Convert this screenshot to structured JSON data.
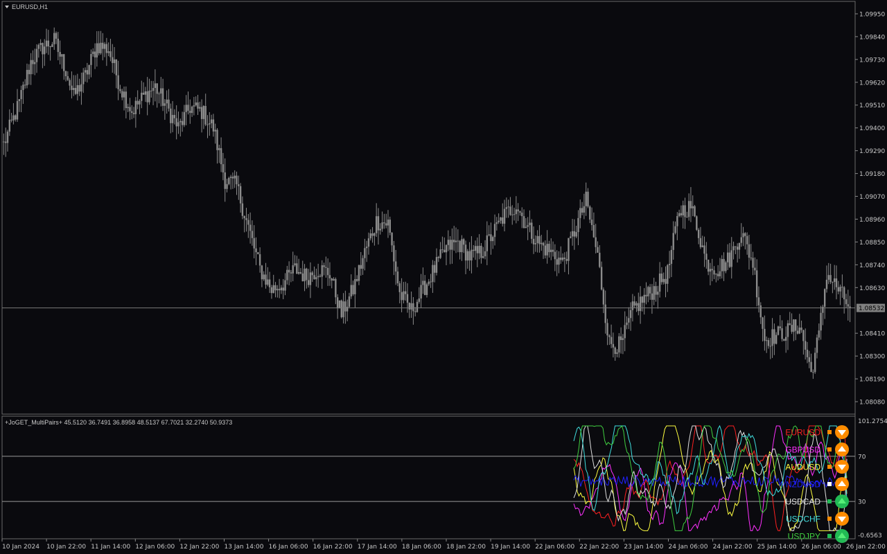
{
  "window": {
    "symbol_title": "EURUSD,H1",
    "indicator_title": "+JoGET_MultiPairs+ 45.5120 36.7491 36.8958 48.5137 67.7021 32.2740 50.9373"
  },
  "colors": {
    "background": "#0a0a0e",
    "candle": "#8c8c8c",
    "grid": "#5a5a5a",
    "axis_text": "#c8c8c8",
    "current_price_bg": "#808080",
    "arrow_up": "#22bb55",
    "arrow_down": "#ff8c00"
  },
  "chart_data": [
    {
      "type": "candlestick",
      "title": "EURUSD,H1",
      "symbol": "EURUSD",
      "timeframe": "H1",
      "y_ticks": [
        "1.09950",
        "1.09840",
        "1.09730",
        "1.09620",
        "1.09510",
        "1.09400",
        "1.09290",
        "1.09180",
        "1.09070",
        "1.08960",
        "1.08850",
        "1.08740",
        "1.08630",
        "1.08532",
        "1.08410",
        "1.08300",
        "1.08190",
        "1.08080"
      ],
      "ylim": [
        1.0802,
        1.1001
      ],
      "current_price": 1.08532,
      "current_price_label": "1.08532",
      "x_ticks": [
        "10 Jan 2024",
        "10 Jan 22:00",
        "11 Jan 14:00",
        "12 Jan 06:00",
        "12 Jan 22:00",
        "13 Jan 14:00",
        "16 Jan 06:00",
        "16 Jan 22:00",
        "17 Jan 14:00",
        "18 Jan 06:00",
        "18 Jan 22:00",
        "19 Jan 14:00",
        "22 Jan 06:00",
        "22 Jan 22:00",
        "23 Jan 14:00",
        "24 Jan 06:00",
        "24 Jan 22:00",
        "25 Jan 14:00",
        "26 Jan 06:00",
        "26 Jan 22:00"
      ],
      "close_anchors": [
        [
          0,
          1.0932
        ],
        [
          8,
          1.0952
        ],
        [
          14,
          1.0972
        ],
        [
          20,
          1.0979
        ],
        [
          26,
          1.0982
        ],
        [
          32,
          1.0968
        ],
        [
          36,
          1.0955
        ],
        [
          42,
          1.0965
        ],
        [
          48,
          1.098
        ],
        [
          54,
          1.0978
        ],
        [
          60,
          1.096
        ],
        [
          66,
          1.0948
        ],
        [
          72,
          1.0955
        ],
        [
          78,
          1.096
        ],
        [
          84,
          1.095
        ],
        [
          90,
          1.094
        ],
        [
          96,
          1.095
        ],
        [
          102,
          1.0948
        ],
        [
          108,
          1.094
        ],
        [
          114,
          1.0915
        ],
        [
          120,
          1.0912
        ],
        [
          126,
          1.0892
        ],
        [
          132,
          1.0872
        ],
        [
          138,
          1.0862
        ],
        [
          144,
          1.0865
        ],
        [
          150,
          1.0872
        ],
        [
          156,
          1.0868
        ],
        [
          162,
          1.0872
        ],
        [
          168,
          1.087
        ],
        [
          174,
          1.085
        ],
        [
          180,
          1.0862
        ],
        [
          186,
          1.088
        ],
        [
          192,
          1.0895
        ],
        [
          198,
          1.0894
        ],
        [
          204,
          1.086
        ],
        [
          210,
          1.0852
        ],
        [
          216,
          1.0862
        ],
        [
          222,
          1.0872
        ],
        [
          228,
          1.0882
        ],
        [
          234,
          1.0885
        ],
        [
          240,
          1.0878
        ],
        [
          246,
          1.088
        ],
        [
          252,
          1.0889
        ],
        [
          258,
          1.0898
        ],
        [
          264,
          1.0903
        ],
        [
          270,
          1.0892
        ],
        [
          276,
          1.0884
        ],
        [
          282,
          1.088
        ],
        [
          288,
          1.0875
        ],
        [
          294,
          1.089
        ],
        [
          300,
          1.0905
        ],
        [
          306,
          1.0878
        ],
        [
          312,
          1.0836
        ],
        [
          318,
          1.0835
        ],
        [
          324,
          1.0852
        ],
        [
          330,
          1.0858
        ],
        [
          336,
          1.0863
        ],
        [
          342,
          1.087
        ],
        [
          348,
          1.09
        ],
        [
          354,
          1.0902
        ],
        [
          358,
          1.089
        ],
        [
          362,
          1.0875
        ],
        [
          368,
          1.0872
        ],
        [
          374,
          1.0877
        ],
        [
          380,
          1.089
        ],
        [
          386,
          1.0875
        ],
        [
          392,
          1.0838
        ],
        [
          398,
          1.084
        ],
        [
          404,
          1.0842
        ],
        [
          410,
          1.0845
        ],
        [
          416,
          1.0822
        ],
        [
          420,
          1.084
        ],
        [
          424,
          1.087
        ],
        [
          430,
          1.0862
        ],
        [
          436,
          1.0853
        ]
      ],
      "n_bars": 437
    },
    {
      "type": "line",
      "title": "+JoGET_MultiPairs+",
      "values_label": "45.5120 36.7491 36.8958 48.5137 67.7021 32.2740 50.9373",
      "y_ticks": [
        "101.2754",
        "70",
        "30",
        "-0.6563"
      ],
      "ylim": [
        -0.6563,
        101.2754
      ],
      "levels": [
        70,
        30
      ],
      "n_points": 160,
      "series": [
        {
          "name": "EURUSD",
          "color": "#ff2020",
          "last": 45.512,
          "signal": "down",
          "swatch": "#ff8c00"
        },
        {
          "name": "GBPUSD",
          "color": "#ff30ff",
          "last": 36.7491,
          "signal": "up",
          "swatch": "#ff8c00"
        },
        {
          "name": "AUDUSD",
          "color": "#ffff40",
          "last": 36.8958,
          "signal": "down",
          "swatch": "#ff8c00"
        },
        {
          "name": "NZDUSD",
          "color": "#2020ff",
          "last": 48.5137,
          "signal": "up",
          "swatch": "#ffffff"
        },
        {
          "name": "USDCAD",
          "color": "#e0e0e0",
          "last": 67.7021,
          "signal": "up",
          "swatch": "#22bb55"
        },
        {
          "name": "USDCHF",
          "color": "#40e0e0",
          "last": 32.274,
          "signal": "down",
          "swatch": "#ff8c00"
        },
        {
          "name": "USDJPY",
          "color": "#40d040",
          "last": 50.9373,
          "signal": "up",
          "swatch": "#22bb55"
        }
      ]
    }
  ]
}
